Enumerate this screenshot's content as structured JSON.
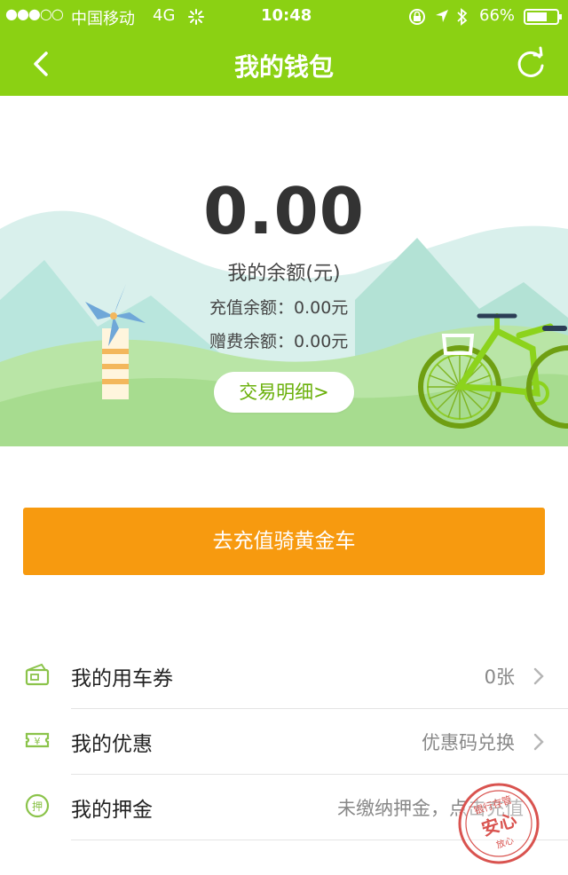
{
  "status_bar": {
    "signal": "●●●○○",
    "carrier": "中国移动",
    "network": "4G",
    "time": "10:48",
    "battery": "66%"
  },
  "nav": {
    "title": "我的钱包",
    "back_icon": "chevron-left-icon",
    "refresh_icon": "refresh-icon"
  },
  "wallet": {
    "balance": "0.00",
    "balance_label": "我的余额(元)",
    "recharge_balance": "充值余额：0.00元",
    "bonus_balance": "赠费余额：0.00元",
    "transactions_button": "交易明细>"
  },
  "recharge_button": "去充值骑黄金车",
  "menu": [
    {
      "label": "我的用车券",
      "value": "0张",
      "icon": "ticket-icon"
    },
    {
      "label": "我的优惠",
      "value": "优惠码兑换",
      "icon": "coupon-icon"
    },
    {
      "label": "我的押金",
      "value": "未缴纳押金，点击充值",
      "icon": "deposit-icon"
    }
  ],
  "stamp": {
    "text_top": "银行存管",
    "text_main": "安心",
    "text_bottom": "放心"
  },
  "colors": {
    "brand_green": "#8bd113",
    "orange": "#f79a0f"
  }
}
